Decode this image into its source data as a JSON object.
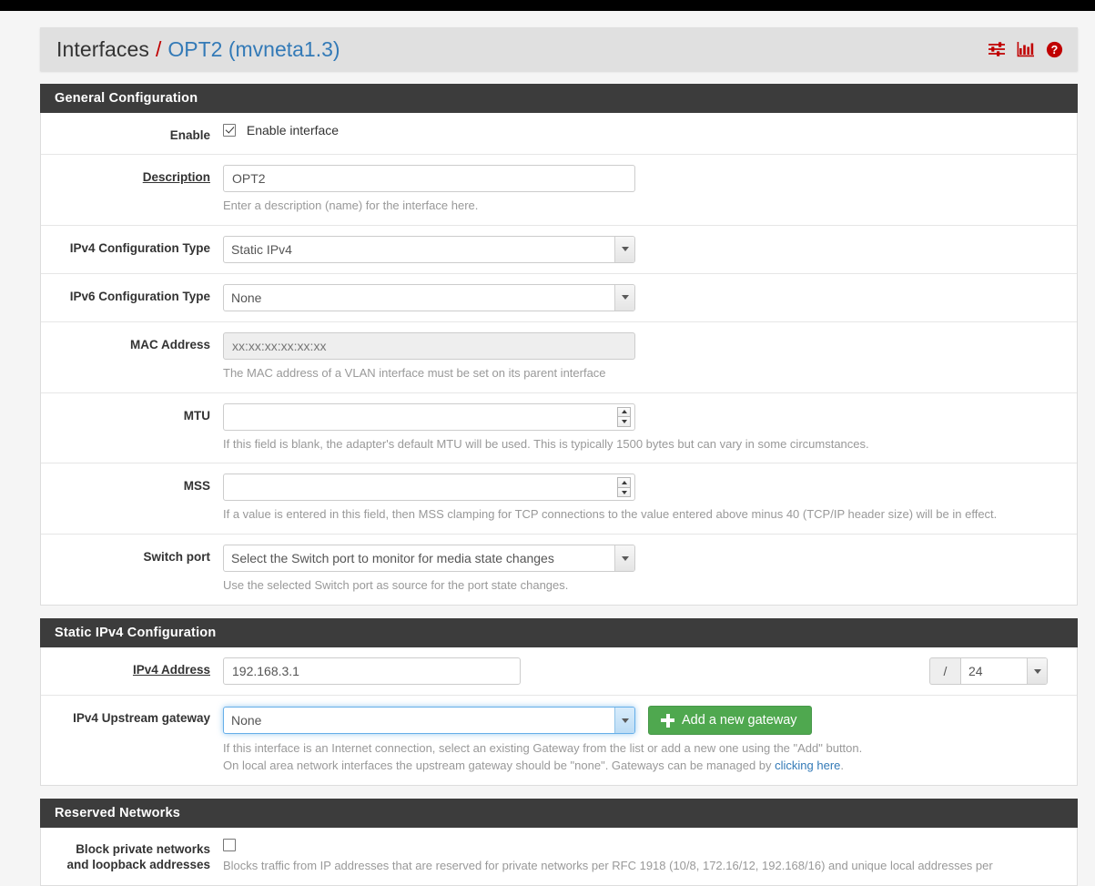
{
  "breadcrumb": {
    "root": "Interfaces",
    "separator": "/",
    "current": "OPT2 (mvneta1.3)"
  },
  "header_icons": [
    {
      "name": "sliders-icon",
      "title": "Advanced"
    },
    {
      "name": "chart-icon",
      "title": "Status"
    },
    {
      "name": "help-icon",
      "title": "Help"
    }
  ],
  "colors": {
    "accent_red": "#c00000",
    "link_blue": "#337ab7",
    "panel_header": "#3c3c3c",
    "button_green": "#4fa84f",
    "focus_blue": "#66afe9"
  },
  "general": {
    "title": "General Configuration",
    "enable": {
      "label": "Enable",
      "checkbox_label": "Enable interface",
      "checked": true
    },
    "description": {
      "label": "Description",
      "value": "OPT2",
      "help": "Enter a description (name) for the interface here."
    },
    "ipv4_config_type": {
      "label": "IPv4 Configuration Type",
      "value": "Static IPv4"
    },
    "ipv6_config_type": {
      "label": "IPv6 Configuration Type",
      "value": "None"
    },
    "mac_address": {
      "label": "MAC Address",
      "value": "",
      "placeholder": "xx:xx:xx:xx:xx:xx",
      "disabled": true,
      "help": "The MAC address of a VLAN interface must be set on its parent interface"
    },
    "mtu": {
      "label": "MTU",
      "value": "",
      "help": "If this field is blank, the adapter's default MTU will be used. This is typically 1500 bytes but can vary in some circumstances."
    },
    "mss": {
      "label": "MSS",
      "value": "",
      "help": "If a value is entered in this field, then MSS clamping for TCP connections to the value entered above minus 40 (TCP/IP header size) will be in effect."
    },
    "switch_port": {
      "label": "Switch port",
      "value": "Select the Switch port to monitor for media state changes",
      "help": "Use the selected Switch port as source for the port state changes."
    }
  },
  "static_ipv4": {
    "title": "Static IPv4 Configuration",
    "address": {
      "label": "IPv4 Address",
      "value": "192.168.3.1"
    },
    "subnet": {
      "prefix": "/",
      "value": "24"
    },
    "gateway": {
      "label": "IPv4 Upstream gateway",
      "value": "None",
      "add_button": "Add a new gateway",
      "help_line1": "If this interface is an Internet connection, select an existing Gateway from the list or add a new one using the \"Add\" button.",
      "help_line2_before": "On local area network interfaces the upstream gateway should be \"none\". Gateways can be managed by ",
      "help_link": "clicking here",
      "help_line2_after": "."
    }
  },
  "reserved_networks": {
    "title": "Reserved Networks",
    "block_private": {
      "label_line1": "Block private networks",
      "label_line2": "and loopback addresses",
      "checked": false,
      "help": "Blocks traffic from IP addresses that are reserved for private networks per RFC 1918 (10/8, 172.16/12, 192.168/16) and unique local addresses per"
    }
  }
}
